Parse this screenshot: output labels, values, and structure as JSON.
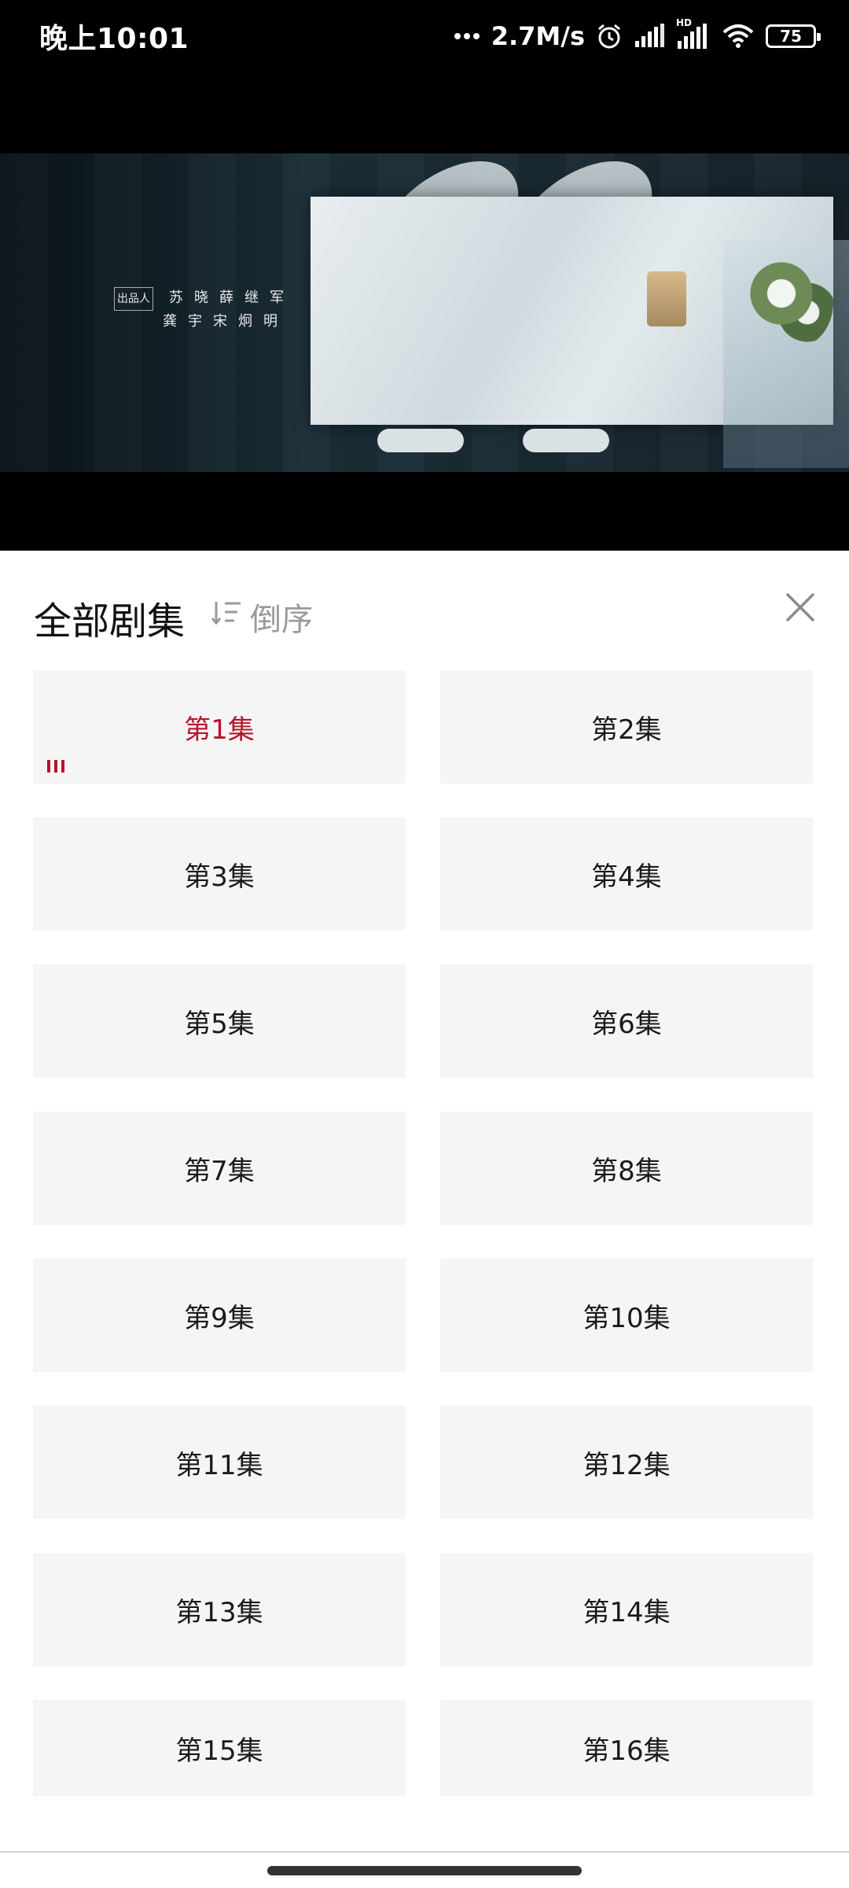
{
  "status_bar": {
    "time": "晚上10:01",
    "net_speed": "2.7M/s",
    "battery": "75",
    "icons": [
      "dots-icon",
      "alarm-icon",
      "signal-icon",
      "hd-signal-icon",
      "wifi-icon",
      "battery-icon"
    ],
    "hd_label": "HD"
  },
  "video": {
    "credit_label": "出品人",
    "credits_row1": [
      "苏",
      "晓",
      "薛",
      "继",
      "军"
    ],
    "credits_row2": [
      "龚",
      "宇",
      "宋",
      "炯",
      "明"
    ]
  },
  "panel": {
    "title": "全部剧集",
    "sort_label": "倒序",
    "sort_icon": "sort-descending-icon",
    "close_icon": "close-icon"
  },
  "episodes": [
    {
      "label": "第1集",
      "active": true
    },
    {
      "label": "第2集",
      "active": false
    },
    {
      "label": "第3集",
      "active": false
    },
    {
      "label": "第4集",
      "active": false
    },
    {
      "label": "第5集",
      "active": false
    },
    {
      "label": "第6集",
      "active": false
    },
    {
      "label": "第7集",
      "active": false
    },
    {
      "label": "第8集",
      "active": false
    },
    {
      "label": "第9集",
      "active": false
    },
    {
      "label": "第10集",
      "active": false
    },
    {
      "label": "第11集",
      "active": false
    },
    {
      "label": "第12集",
      "active": false
    },
    {
      "label": "第13集",
      "active": false
    },
    {
      "label": "第14集",
      "active": false
    },
    {
      "label": "第15集",
      "active": false
    },
    {
      "label": "第16集",
      "active": false
    }
  ],
  "colors": {
    "accent": "#b8132c",
    "tile_bg": "#f5f5f5",
    "sort_text": "#9a9a9a"
  }
}
